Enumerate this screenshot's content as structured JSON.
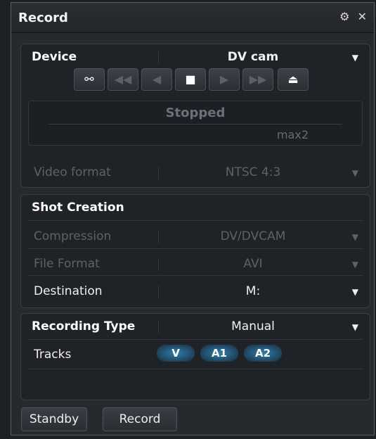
{
  "window": {
    "title": "Record",
    "icons": [
      "gear-icon",
      "close-icon"
    ]
  },
  "device": {
    "heading": "Device",
    "value": "DV cam",
    "transport_icons": [
      "remote-plug-icon",
      "rewind-icon",
      "step-back-icon",
      "stop-icon",
      "play-icon",
      "fast-forward-icon",
      "eject-icon"
    ],
    "status": "Stopped",
    "status_sub": "max2",
    "video_format_label": "Video format",
    "video_format_value": "NTSC 4:3"
  },
  "shot_creation": {
    "heading": "Shot Creation",
    "compression_label": "Compression",
    "compression_value": "DV/DVCAM",
    "file_format_label": "File Format",
    "file_format_value": "AVI",
    "destination_label": "Destination",
    "destination_value": "M:"
  },
  "recording_type": {
    "heading": "Recording Type",
    "value": "Manual",
    "tracks_label": "Tracks",
    "tracks": [
      "V",
      "A1",
      "A2"
    ]
  },
  "buttons": {
    "standby": "Standby",
    "record": "Record"
  },
  "colors": {
    "accent_track": "#2f7fae",
    "background": "#26292e"
  }
}
